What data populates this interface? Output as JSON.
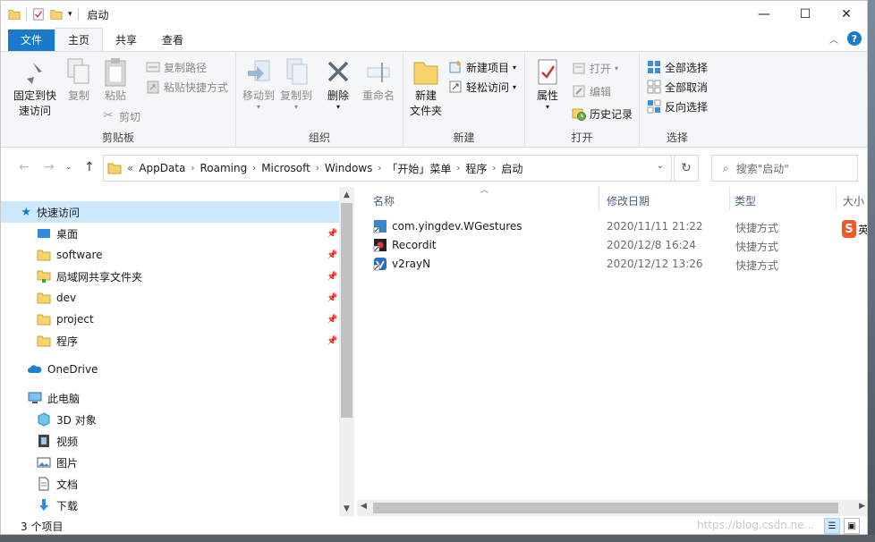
{
  "window": {
    "title": "启动"
  },
  "window_controls": {
    "minimize": "—",
    "maximize": "☐",
    "close": "✕"
  },
  "tabs": {
    "file": "文件",
    "home": "主页",
    "share": "共享",
    "view": "查看"
  },
  "ribbon": {
    "clipboard": {
      "label": "剪贴板",
      "pin_quick_access": [
        "固定到快",
        "速访问"
      ],
      "copy": "复制",
      "paste": "粘贴",
      "copy_path": "复制路径",
      "paste_shortcut": "粘贴快捷方式",
      "cut": "剪切"
    },
    "organize": {
      "label": "组织",
      "move_to": "移动到",
      "copy_to": "复制到",
      "delete": "删除",
      "rename": "重命名"
    },
    "new": {
      "label": "新建",
      "new_folder": [
        "新建",
        "文件夹"
      ],
      "new_item": "新建项目",
      "easy_access": "轻松访问"
    },
    "open": {
      "label": "打开",
      "properties": "属性",
      "open": "打开",
      "edit": "编辑",
      "history": "历史记录"
    },
    "select": {
      "label": "选择",
      "select_all": "全部选择",
      "select_none": "全部取消",
      "invert": "反向选择"
    }
  },
  "address": {
    "prefix": "«",
    "crumbs": [
      "AppData",
      "Roaming",
      "Microsoft",
      "Windows",
      "「开始」菜单",
      "程序",
      "启动"
    ],
    "search_placeholder": "搜索\"启动\""
  },
  "nav": {
    "quick_access": "快速访问",
    "pinned": [
      "桌面",
      "software",
      "局域网共享文件夹",
      "dev",
      "project",
      "程序"
    ],
    "onedrive": "OneDrive",
    "this_pc": "此电脑",
    "pc_items": [
      "3D 对象",
      "视频",
      "图片",
      "文档",
      "下载"
    ]
  },
  "columns": {
    "name": "名称",
    "modified": "修改日期",
    "type": "类型",
    "size": "大小"
  },
  "files": [
    {
      "name": "com.yingdev.WGestures",
      "modified": "2020/11/11 21:22",
      "type": "快捷方式"
    },
    {
      "name": "Recordit",
      "modified": "2020/12/8 16:24",
      "type": "快捷方式"
    },
    {
      "name": "v2rayN",
      "modified": "2020/12/12 13:26",
      "type": "快捷方式"
    }
  ],
  "status": {
    "count": "3 个项目",
    "watermark": "https://blog.csdn.ne..."
  },
  "ime": {
    "label": "英"
  },
  "colors": {
    "accent": "#1979ca",
    "selection": "#cce8ff",
    "folder": "#f8d36b"
  }
}
